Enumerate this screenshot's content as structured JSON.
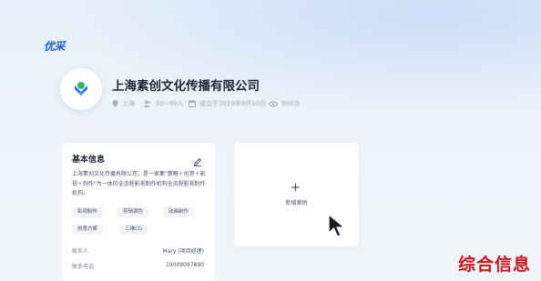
{
  "brand": "优采",
  "company": {
    "name": "上海素创文化传播有限公司",
    "location": "上海",
    "team_size": "50~99人",
    "founded": "成立于2019年8月10日",
    "views": "900次"
  },
  "basic_info": {
    "title": "基本信息",
    "description": "上海素创文化传播有限公司，是一家集\"策略＋创意＋影视＋制作\"为一体的全流程影视制作机构全流程影视制作机构。",
    "tags": [
      "影视制作",
      "剪辑调色",
      "动画制作",
      "创意方案",
      "三维CG"
    ],
    "contact_label": "联系人",
    "contact_value": "Mary (项目经理)",
    "phone_label": "联系电话",
    "phone_value": "19009097890"
  },
  "add_case": {
    "label": "新增案例"
  },
  "watermark": "综合信息",
  "colors": {
    "brand": "#1f5fd6",
    "watermark": "#c8161d"
  },
  "icons": [
    "edit-icon",
    "location-icon",
    "people-icon",
    "calendar-icon",
    "eye-icon",
    "plus-icon",
    "cursor-icon"
  ]
}
